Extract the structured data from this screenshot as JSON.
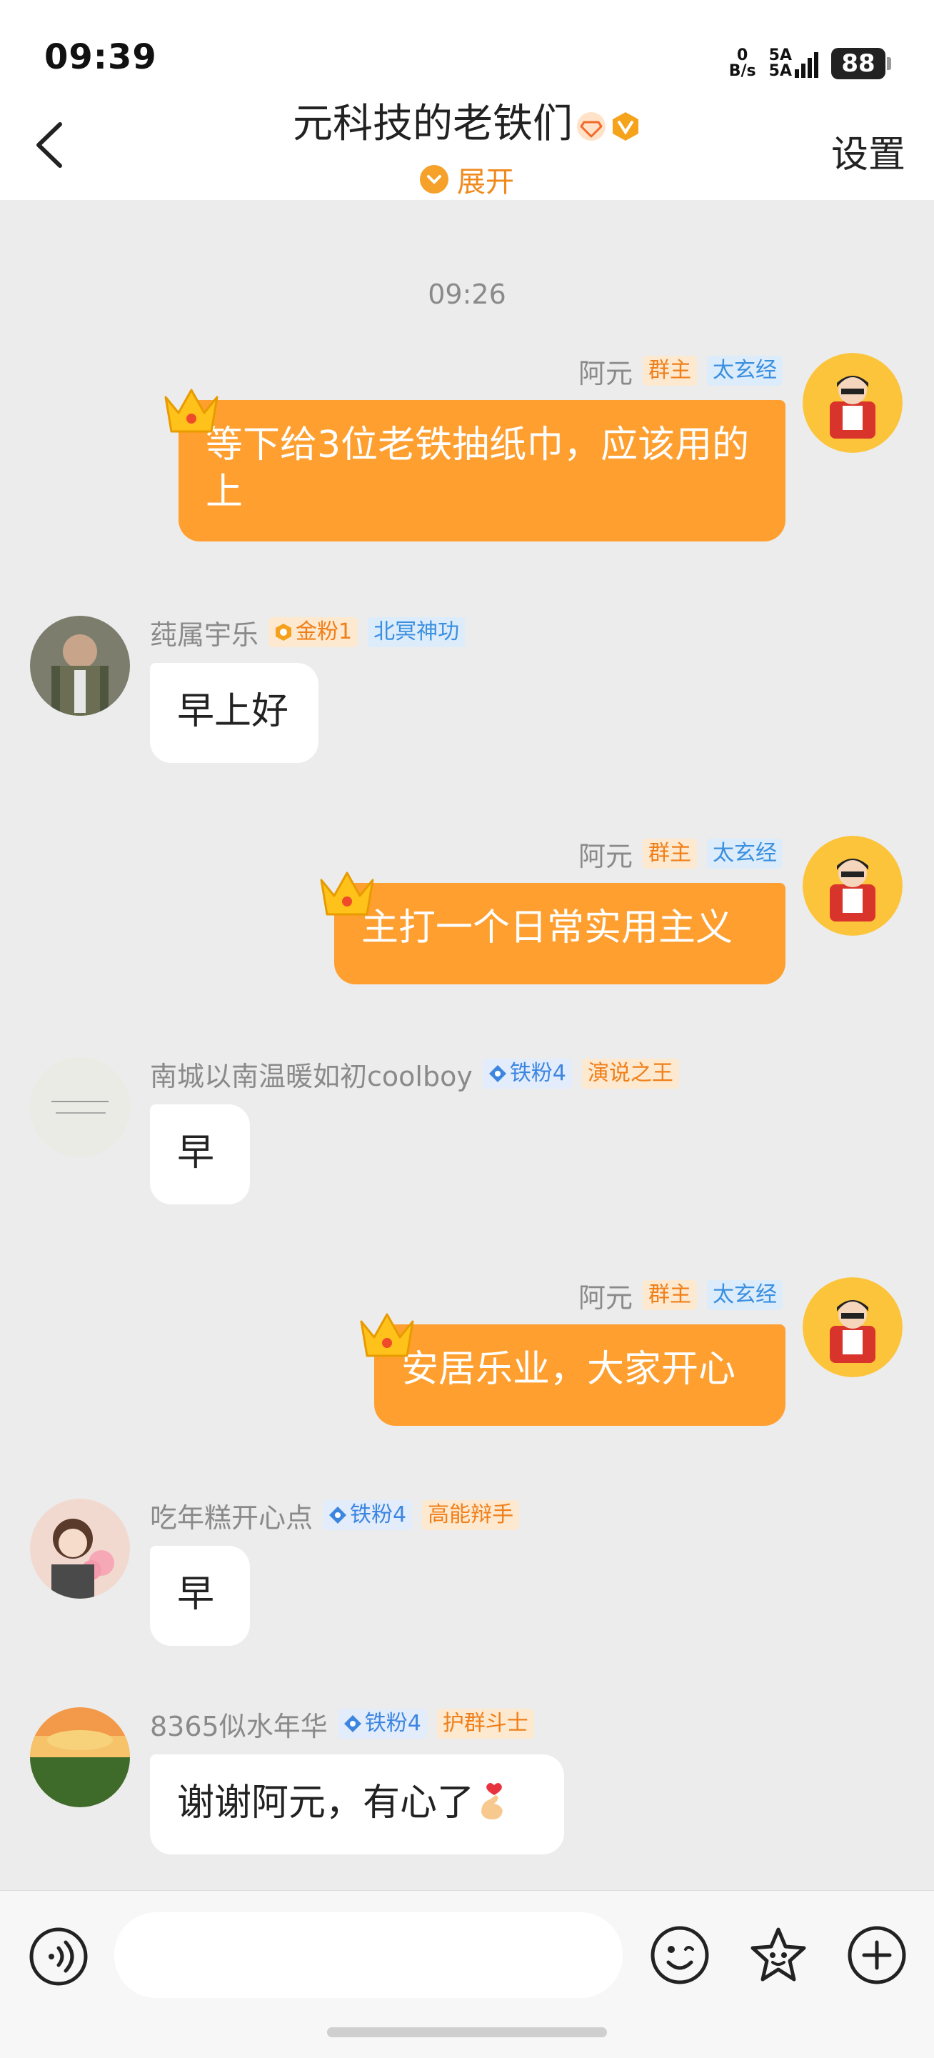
{
  "status_bar": {
    "time": "09:39",
    "net_speed": "0",
    "net_unit": "B/s",
    "sig1": "5A",
    "sig2": "5A",
    "battery": "88"
  },
  "header": {
    "title": "元科技的老铁们",
    "expand_label": "展开",
    "settings_label": "设置"
  },
  "chat": {
    "timestamp": "09:26",
    "messages": [
      {
        "sender": "阿元",
        "badge1": "群主",
        "badge2": "太玄经",
        "text": "等下给3位老铁抽纸巾，应该用的上",
        "direction": "out"
      },
      {
        "sender": "莼属宇乐",
        "badge1": "金粉1",
        "badge2": "北冥神功",
        "text": "早上好",
        "direction": "in"
      },
      {
        "sender": "阿元",
        "badge1": "群主",
        "badge2": "太玄经",
        "text": "主打一个日常实用主义",
        "direction": "out"
      },
      {
        "sender": "南城以南温暖如初coolboy",
        "badge1": "铁粉4",
        "badge2": "演说之王",
        "text": "早",
        "direction": "in"
      },
      {
        "sender": "阿元",
        "badge1": "群主",
        "badge2": "太玄经",
        "text": "安居乐业，大家开心",
        "direction": "out"
      },
      {
        "sender": "吃年糕开心点",
        "badge1": "铁粉4",
        "badge2": "高能辩手",
        "text": "早",
        "direction": "in"
      },
      {
        "sender": "8365似水年华",
        "badge1": "铁粉4",
        "badge2": "护群斗士",
        "text": "谢谢阿元，有心了",
        "direction": "in"
      }
    ]
  },
  "input_bar": {
    "placeholder": ""
  },
  "colors": {
    "accent": "#fe9f30",
    "background": "#ececec"
  },
  "icons": [
    "back-icon",
    "crown-icon",
    "voice-icon",
    "emoji-icon",
    "sticker-icon",
    "plus-icon"
  ]
}
